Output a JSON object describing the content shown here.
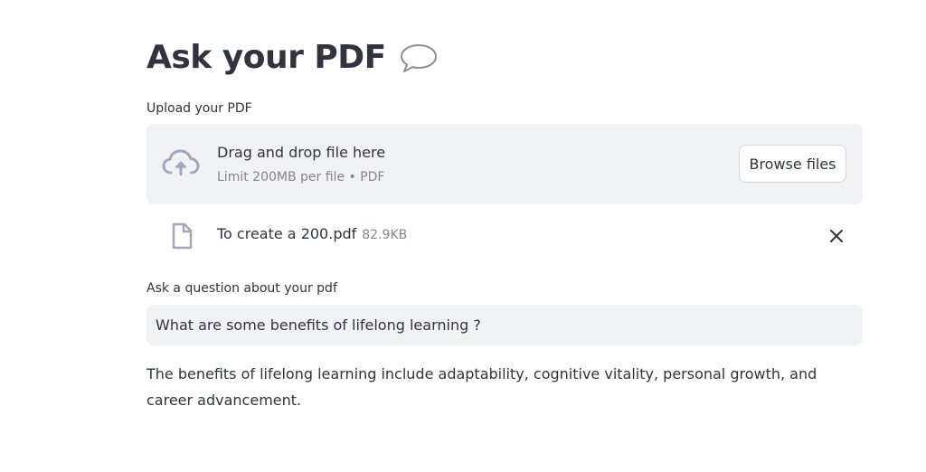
{
  "page": {
    "title": "Ask your PDF",
    "title_icon": "speech-bubble-icon"
  },
  "uploader": {
    "label": "Upload your PDF",
    "drop_text": "Drag and drop file here",
    "limit_text": "Limit 200MB per file • PDF",
    "browse_label": "Browse files",
    "icon": "cloud-upload-icon",
    "uploaded_file": {
      "name": "To create a 200.pdf",
      "size": "82.9KB",
      "icon": "file-icon",
      "remove_icon": "close-icon"
    }
  },
  "question": {
    "label": "Ask a question about your pdf",
    "value": "What are some benefits of lifelong learning ?"
  },
  "answer": {
    "text": "The benefits of lifelong learning include adaptability, cognitive vitality, personal growth, and career advancement."
  },
  "colors": {
    "text": "#31333f",
    "muted": "#808495",
    "panel": "#f0f2f6",
    "icon": "#a3a8b8"
  }
}
